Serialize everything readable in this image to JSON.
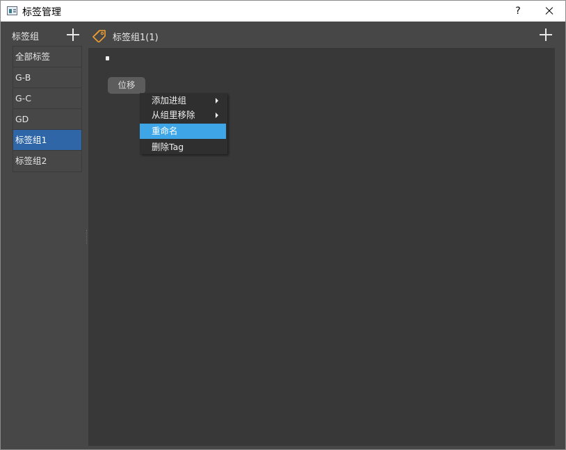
{
  "window": {
    "title": "标签管理",
    "help_label": "?"
  },
  "left_panel": {
    "header_label": "标签组",
    "groups": [
      {
        "label": "全部标签",
        "selected": false
      },
      {
        "label": "G-B",
        "selected": false
      },
      {
        "label": "G-C",
        "selected": false
      },
      {
        "label": "GD",
        "selected": false
      },
      {
        "label": "标签组1",
        "selected": true
      },
      {
        "label": "标签组2",
        "selected": false
      }
    ]
  },
  "right_panel": {
    "group_title": "标签组1(1)",
    "tags": [
      {
        "label": "位移"
      }
    ]
  },
  "context_menu": {
    "items": [
      {
        "label": "添加进组",
        "has_submenu": true
      },
      {
        "label": "从组里移除",
        "has_submenu": true
      },
      {
        "label": "重命名",
        "has_submenu": false,
        "highlighted": true
      },
      {
        "label": "删除Tag",
        "has_submenu": false
      }
    ]
  },
  "colors": {
    "background": "#474747",
    "content_background": "#383838",
    "selected_group": "#2f66a8",
    "menu_highlight": "#3ea6e6",
    "tag_icon": "#f0a030"
  },
  "icons": {
    "app": "app-window-icon",
    "close": "close-icon",
    "add_group": "plus-icon",
    "tag": "tag-icon",
    "add_tag": "plus-icon"
  }
}
